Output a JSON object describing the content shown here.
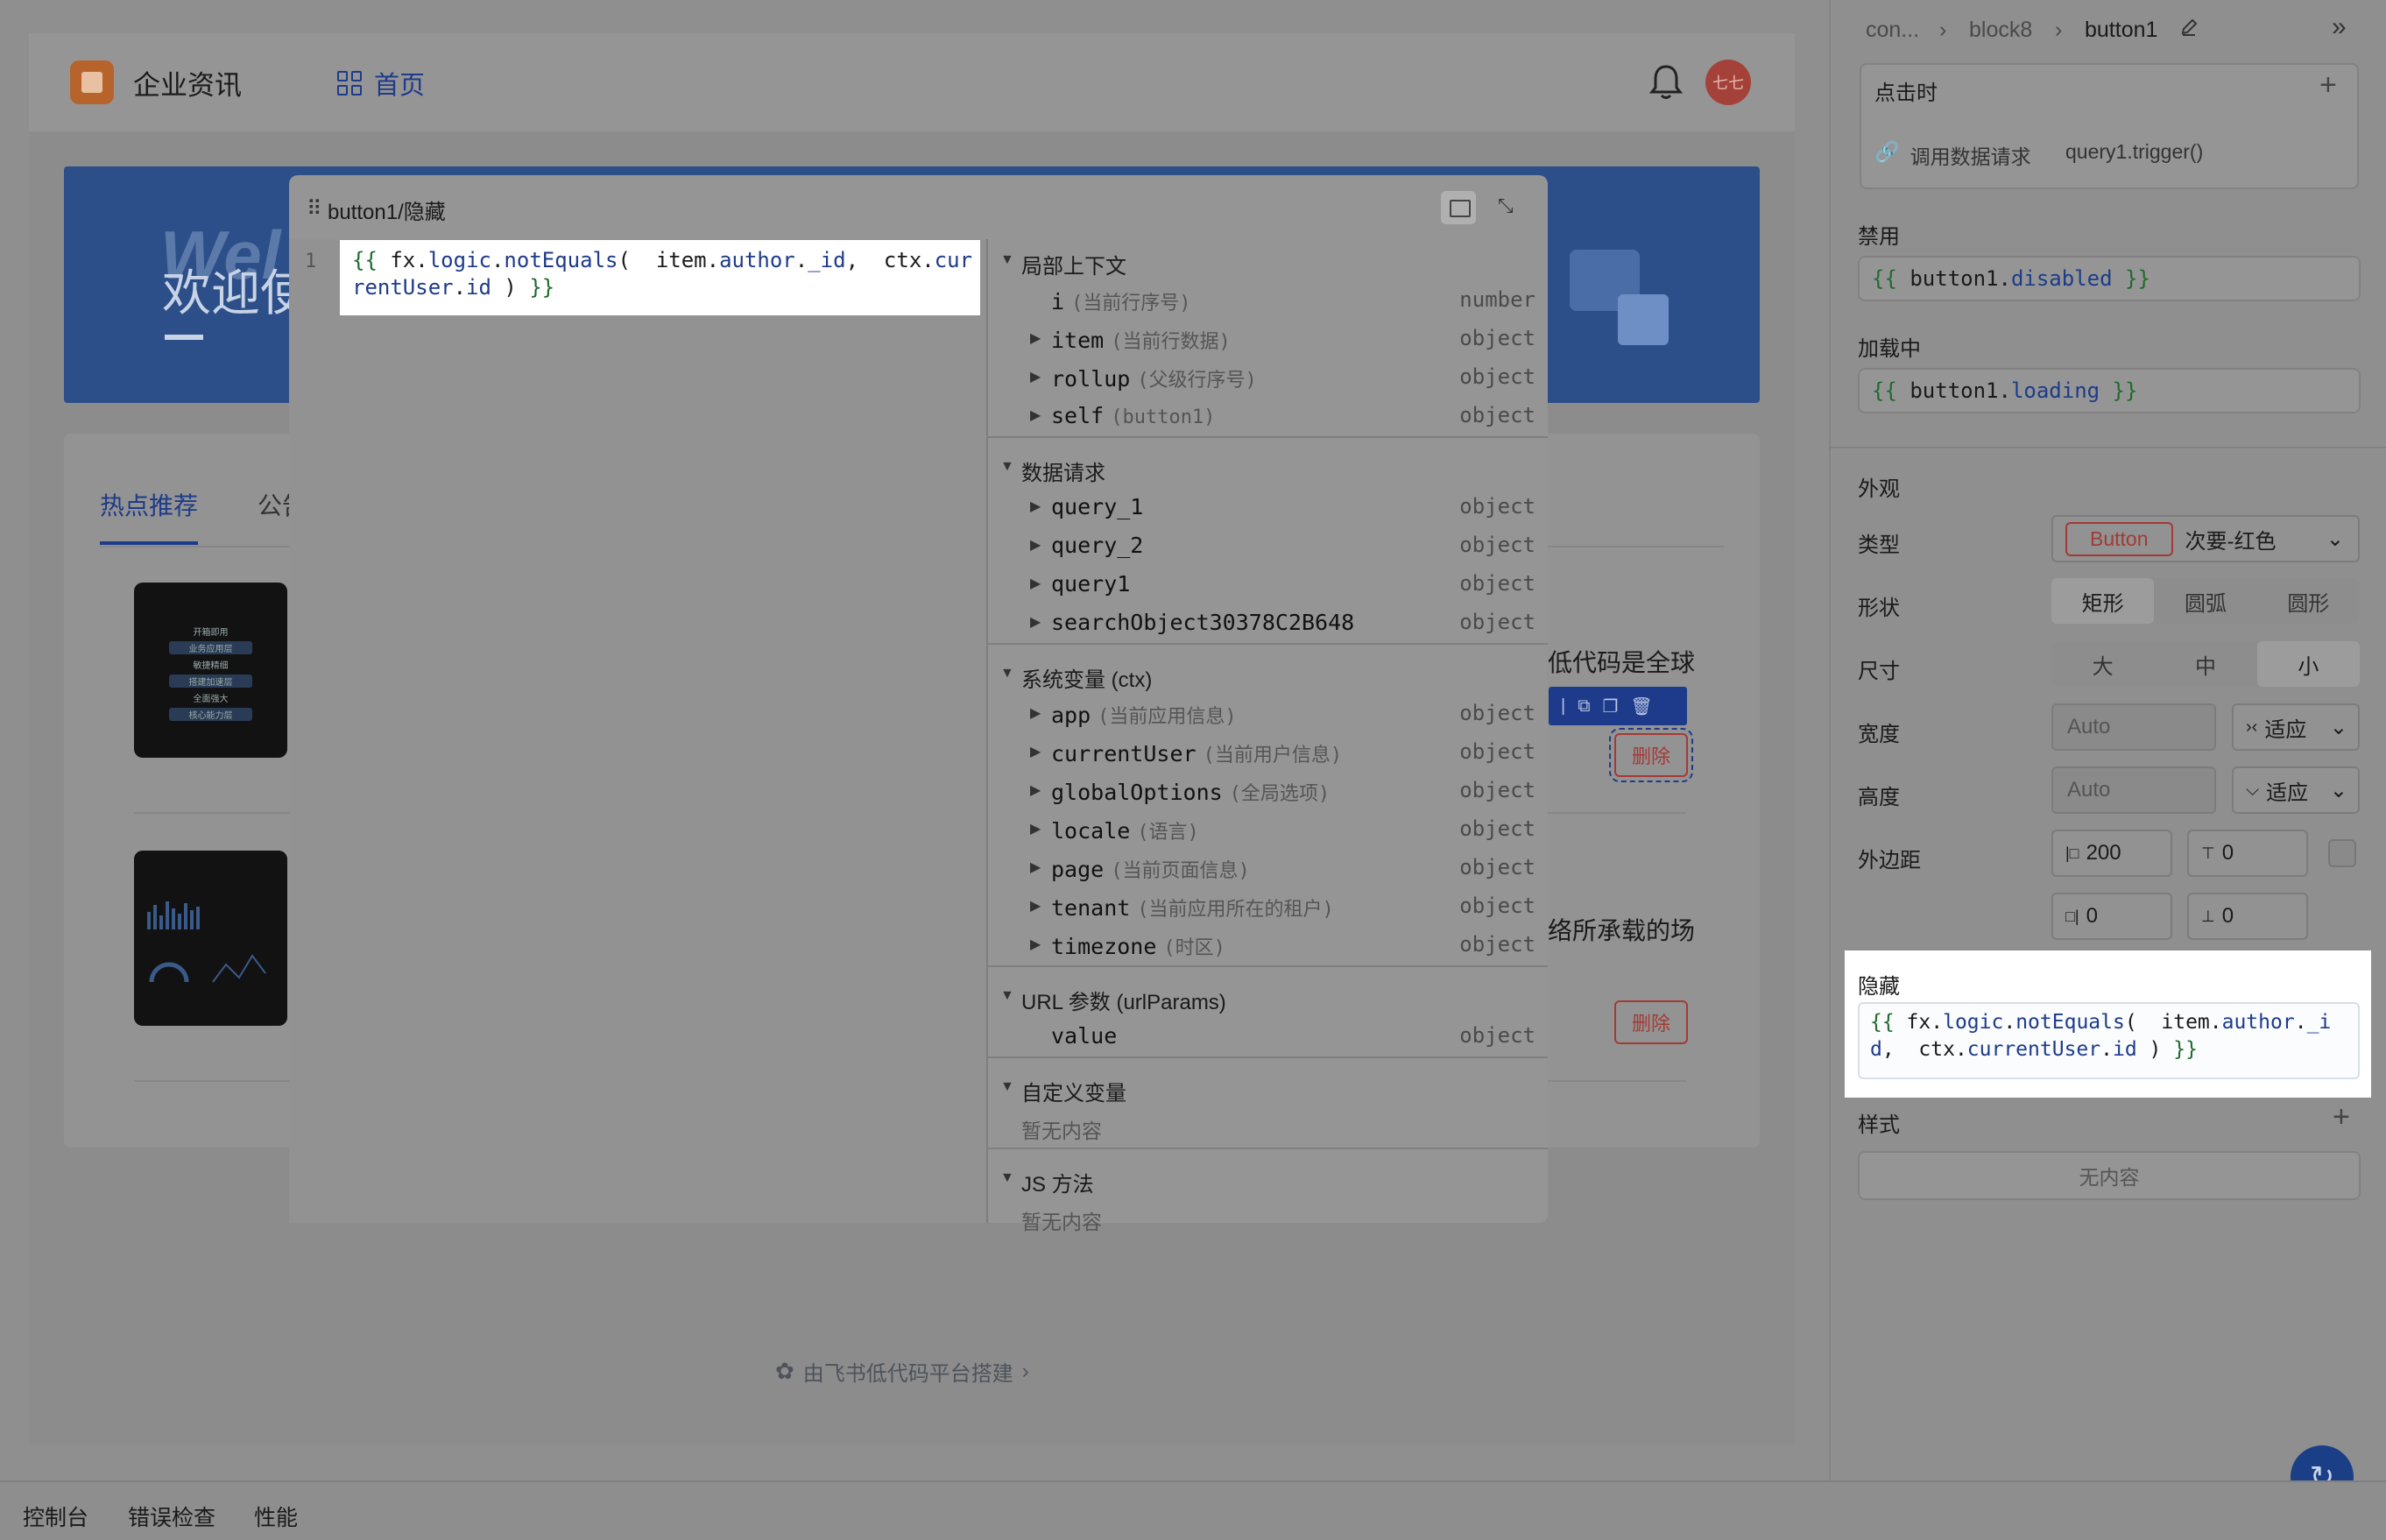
{
  "app": {
    "title": "企业资讯",
    "nav_home": "首页",
    "avatar_text": "七七"
  },
  "banner": {
    "ghost_text": "Wel",
    "title": "欢迎使"
  },
  "content": {
    "tabs": [
      "热点推荐",
      "公告"
    ],
    "row1_text": "低代码是全球",
    "row2_text": "络所承载的场",
    "delete_label": "删除",
    "thumb1_lines": [
      "开箱即用",
      "业务应用层",
      "敏捷精细",
      "搭建加速层",
      "全面强大",
      "核心能力层"
    ],
    "footer_text": "由飞书低代码平台搭建",
    "footer_chevron": "›"
  },
  "popup": {
    "drag_icon": "⠿",
    "title": "button1/隐藏",
    "collapse_icon": "⤡",
    "line_number": "1",
    "code_line1": [
      {
        "t": "{{ ",
        "c": "kw"
      },
      {
        "t": "fx.",
        "c": "pl"
      },
      {
        "t": "logic",
        "c": "fn"
      },
      {
        "t": ".",
        "c": "pl"
      },
      {
        "t": "notEquals",
        "c": "fn"
      },
      {
        "t": "(  item.",
        "c": "pl"
      },
      {
        "t": "author",
        "c": "fn"
      },
      {
        "t": ".",
        "c": "pl"
      },
      {
        "t": "_id",
        "c": "fn"
      },
      {
        "t": ",  ctx.",
        "c": "pl"
      },
      {
        "t": "cur",
        "c": "fn"
      }
    ],
    "code_line2": [
      {
        "t": "rentUser",
        "c": "fn"
      },
      {
        "t": ".",
        "c": "pl"
      },
      {
        "t": "id",
        "c": "fn"
      },
      {
        "t": " ) ",
        "c": "pl"
      },
      {
        "t": "}}",
        "c": "kw"
      }
    ],
    "sections": [
      {
        "title": "局部上下文",
        "items": [
          {
            "name": "i",
            "label": "(当前行序号)",
            "type": "number",
            "expand": false
          },
          {
            "name": "item",
            "label": "(当前行数据)",
            "type": "object",
            "expand": true
          },
          {
            "name": "rollup",
            "label": "(父级行序号)",
            "type": "object",
            "expand": true
          },
          {
            "name": "self",
            "label": "(button1)",
            "type": "object",
            "expand": true
          }
        ]
      },
      {
        "title": "数据请求",
        "items": [
          {
            "name": "query_1",
            "label": "",
            "type": "object",
            "expand": true
          },
          {
            "name": "query_2",
            "label": "",
            "type": "object",
            "expand": true
          },
          {
            "name": "query1",
            "label": "",
            "type": "object",
            "expand": true
          },
          {
            "name": "searchObject30378C2B648",
            "label": "",
            "type": "object",
            "expand": true
          }
        ]
      },
      {
        "title": "系统变量 (ctx)",
        "items": [
          {
            "name": "app",
            "label": "(当前应用信息)",
            "type": "object",
            "expand": true
          },
          {
            "name": "currentUser",
            "label": "(当前用户信息)",
            "type": "object",
            "expand": true
          },
          {
            "name": "globalOptions",
            "label": "(全局选项)",
            "type": "object",
            "expand": true
          },
          {
            "name": "locale",
            "label": "(语言)",
            "type": "object",
            "expand": true
          },
          {
            "name": "page",
            "label": "(当前页面信息)",
            "type": "object",
            "expand": true
          },
          {
            "name": "tenant",
            "label": "(当前应用所在的租户)",
            "type": "object",
            "expand": true
          },
          {
            "name": "timezone",
            "label": "(时区)",
            "type": "object",
            "expand": true
          }
        ]
      },
      {
        "title": "URL 参数 (urlParams)",
        "items": [
          {
            "name": "value",
            "label": "",
            "type": "object",
            "expand": false
          }
        ]
      },
      {
        "title": "自定义变量",
        "empty": "暂无内容",
        "items": []
      },
      {
        "title": "JS 方法",
        "empty": "暂无内容",
        "items": []
      }
    ]
  },
  "panel": {
    "breadcrumb": [
      "con...",
      "block8",
      "button1"
    ],
    "crumb_sep": "›",
    "collapse_icon": "»",
    "onclick_label": "点击时",
    "onclick_action_label": "调用数据请求",
    "onclick_action_value": "query1.trigger()",
    "disabled_label": "禁用",
    "disabled_code": [
      {
        "t": "{{ ",
        "c": "kw"
      },
      {
        "t": "button1.",
        "c": "pl"
      },
      {
        "t": "disabled",
        "c": "fn"
      },
      {
        "t": " }}",
        "c": "kw"
      }
    ],
    "loading_label": "加载中",
    "loading_code": [
      {
        "t": "{{ ",
        "c": "kw"
      },
      {
        "t": "button1.",
        "c": "pl"
      },
      {
        "t": "loading",
        "c": "fn"
      },
      {
        "t": " }}",
        "c": "kw"
      }
    ],
    "appearance_label": "外观",
    "type_label": "类型",
    "type_preview": "Button",
    "type_value": "次要-红色",
    "shape_label": "形状",
    "shape_options": [
      "矩形",
      "圆弧",
      "圆形"
    ],
    "shape_selected": 0,
    "size_label": "尺寸",
    "size_options": [
      "大",
      "中",
      "小"
    ],
    "size_selected": 2,
    "width_label": "宽度",
    "width_placeholder": "Auto",
    "width_mode": "适应",
    "height_label": "高度",
    "height_placeholder": "Auto",
    "height_mode": "适应",
    "margin_label": "外边距",
    "margin_left": "200",
    "margin_top": "0",
    "margin_right": "0",
    "margin_bottom": "0",
    "hidden_label": "隐藏",
    "hidden_code_line1": [
      {
        "t": "{{ ",
        "c": "kw"
      },
      {
        "t": "fx.",
        "c": "pl"
      },
      {
        "t": "logic",
        "c": "fn"
      },
      {
        "t": ".",
        "c": "pl"
      },
      {
        "t": "notEquals",
        "c": "fn"
      },
      {
        "t": "(  item.",
        "c": "pl"
      },
      {
        "t": "author",
        "c": "fn"
      },
      {
        "t": ".",
        "c": "pl"
      },
      {
        "t": "_i",
        "c": "fn"
      }
    ],
    "hidden_code_line2": [
      {
        "t": "d",
        "c": "fn"
      },
      {
        "t": ",  ctx.",
        "c": "pl"
      },
      {
        "t": "currentUser",
        "c": "fn"
      },
      {
        "t": ".",
        "c": "pl"
      },
      {
        "t": "id",
        "c": "fn"
      },
      {
        "t": " ) ",
        "c": "pl"
      },
      {
        "t": "}}",
        "c": "kw"
      }
    ],
    "style_label": "样式",
    "style_empty": "无内容",
    "plus_icon": "+"
  },
  "bottom_bar": {
    "items": [
      "控制台",
      "错误检查",
      "性能"
    ]
  }
}
